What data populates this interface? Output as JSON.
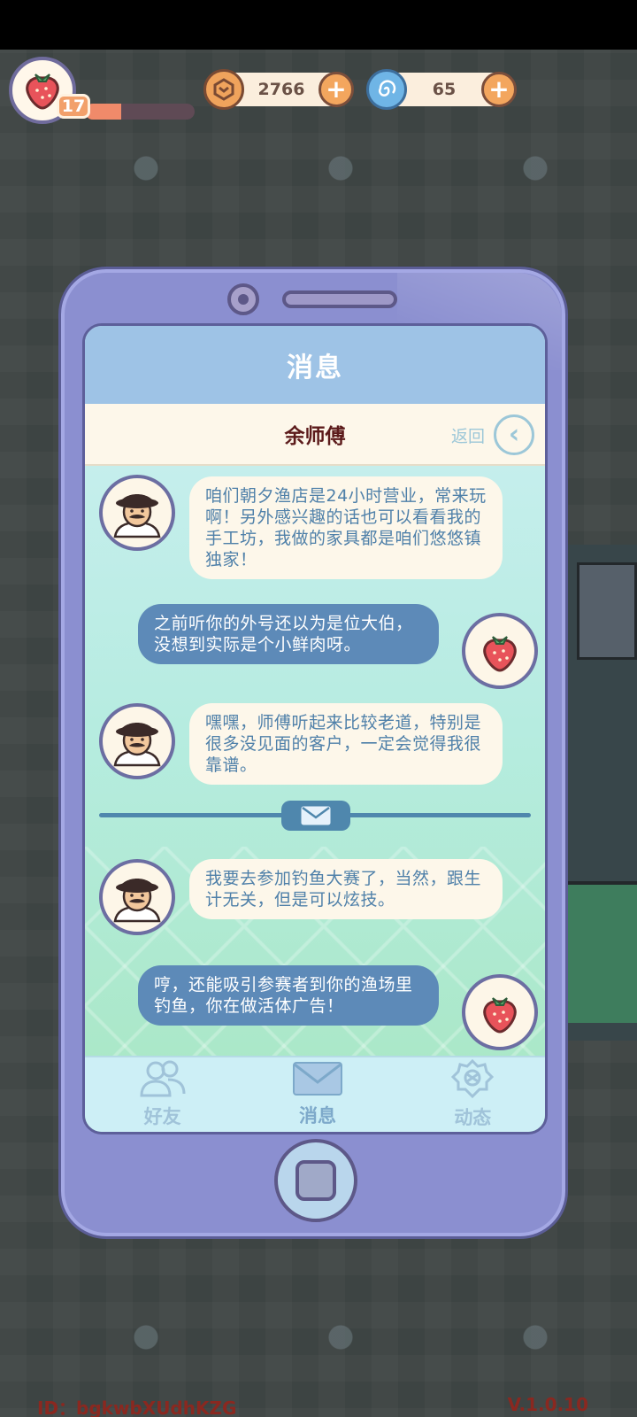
{
  "hud": {
    "level": "17",
    "xp_fraction": 0.33,
    "coins": "2766",
    "gems": "65",
    "avatar_icon": "strawberry-icon",
    "coin_icon": "coin-icon",
    "gem_icon": "spiral-gem-icon",
    "plus_icon": "plus-icon"
  },
  "phone": {
    "title": "消息",
    "contact": "余师傅",
    "back_label": "返回",
    "back_icon": "chevron-left-icon",
    "messages": [
      {
        "from": "npc",
        "text": "咱们朝夕渔店是24小时营业，常来玩啊！另外感兴趣的话也可以看看我的手工坊，我做的家具都是咱们悠悠镇独家！"
      },
      {
        "from": "player",
        "text": "之前听你的外号还以为是位大伯，没想到实际是个小鲜肉呀。"
      },
      {
        "from": "npc",
        "text": "嘿嘿，师傅听起来比较老道，特别是很多没见面的客户，一定会觉得我很靠谱。"
      },
      {
        "from": "npc",
        "text": "我要去参加钓鱼大赛了，当然，跟生计无关，但是可以炫技。"
      },
      {
        "from": "player",
        "text": "哼，还能吸引参赛者到你的渔场里钓鱼，你在做活体广告！"
      }
    ],
    "tabs": [
      {
        "label": "好友",
        "icon": "friends-icon",
        "active": false
      },
      {
        "label": "消息",
        "icon": "envelope-icon",
        "active": true
      },
      {
        "label": "动态",
        "icon": "moments-icon",
        "active": false
      }
    ]
  },
  "footer": {
    "id": "ID：bgkwbXUdhKZG",
    "version": "V.1.0.10"
  },
  "colors": {
    "phone_body": "#8b8fd0",
    "title_bar": "#9ec3e6",
    "npc_bubble": "#fdf7ea",
    "player_bubble": "#5d8ab8",
    "plus_button": "#f3a65e"
  }
}
